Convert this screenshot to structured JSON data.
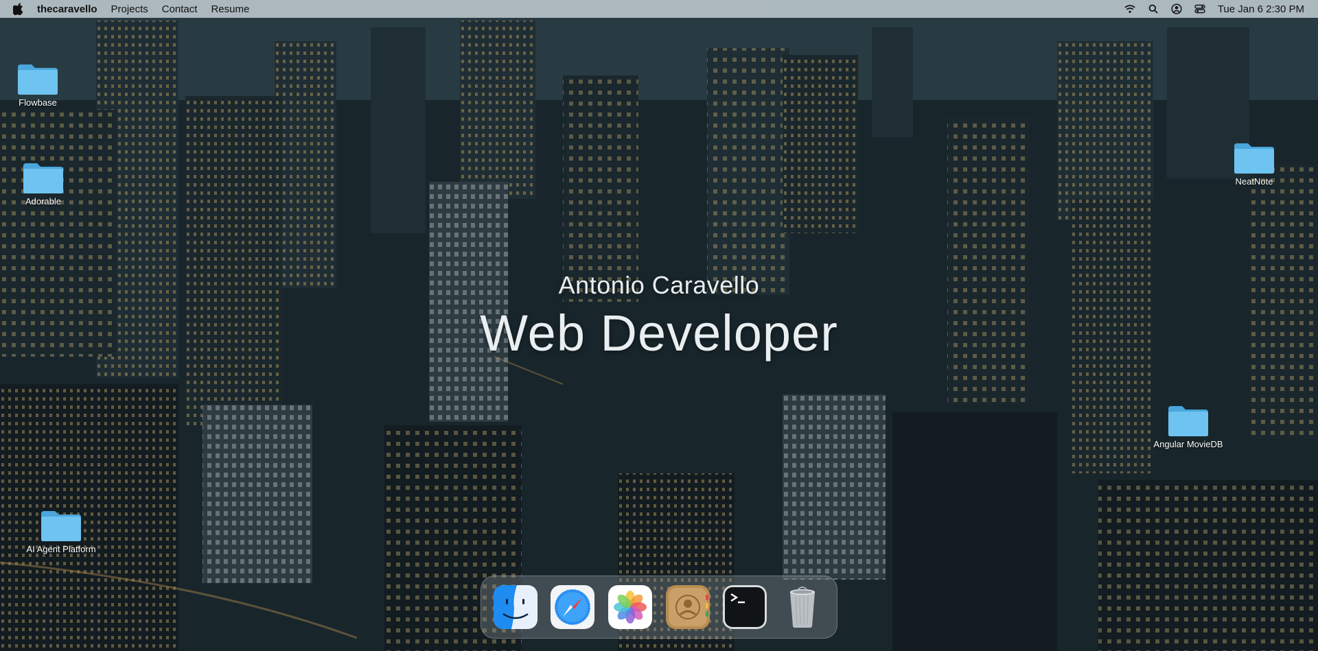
{
  "menubar": {
    "apple_icon": "apple-logo-icon",
    "brand": "thecaravello",
    "items": [
      {
        "label": "Projects"
      },
      {
        "label": "Contact"
      },
      {
        "label": "Resume"
      }
    ],
    "status_icons": [
      "wifi-icon",
      "search-icon",
      "user-icon",
      "control-center-icon"
    ],
    "clock": "Tue Jan 6  2:30 PM"
  },
  "desktop": {
    "folders": [
      {
        "label": "Flowbase"
      },
      {
        "label": "Adorable"
      },
      {
        "label": "NeatNote"
      },
      {
        "label": "Angular MovieDB"
      },
      {
        "label": "AI Agent Platform"
      }
    ],
    "folder_color": "#5fb8e8"
  },
  "hero": {
    "name": "Antonio Caravello",
    "role": "Web Developer"
  },
  "dock": {
    "apps": [
      {
        "name": "finder-icon"
      },
      {
        "name": "safari-icon"
      },
      {
        "name": "photos-icon"
      },
      {
        "name": "contacts-icon"
      },
      {
        "name": "terminal-icon"
      },
      {
        "name": "trash-icon"
      }
    ]
  }
}
